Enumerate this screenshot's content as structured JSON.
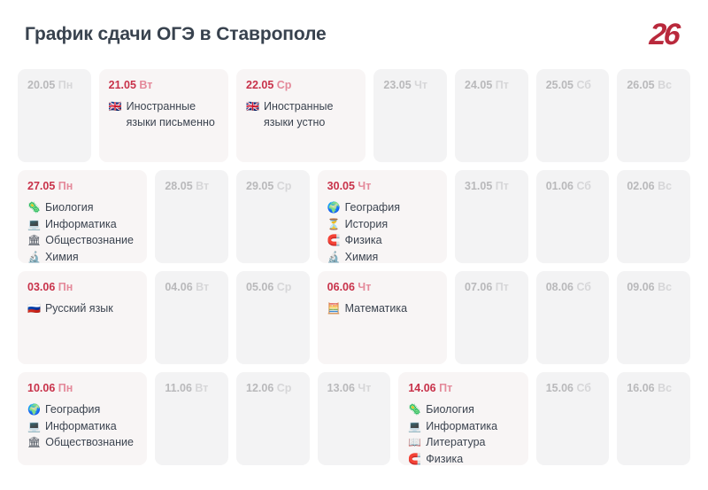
{
  "header": {
    "title": "График сдачи ОГЭ в Ставрополе",
    "logo_text": "26",
    "logo_icon": "logo-26-icon",
    "brand_color": "#b9293c"
  },
  "colors": {
    "title": "#38424e",
    "active_date": "#c8324a",
    "active_dow": "#e4899a",
    "inactive_date": "#b9b9bb",
    "inactive_dow": "#d6d6d8",
    "cell_inactive_bg": "#f3f3f4",
    "cell_active_bg": "#f8f5f5",
    "subject_text": "#3c4450",
    "page_bg": "#ffffff"
  },
  "calendar": {
    "weeks": [
      {
        "days": [
          {
            "date": "20.05",
            "dow": "Пн",
            "active": false,
            "subjects": []
          },
          {
            "date": "21.05",
            "dow": "Вт",
            "active": true,
            "subjects": [
              {
                "icon": "🇬🇧",
                "icon_name": "uk-flag-icon",
                "label": "Иностранные языки письменно"
              }
            ]
          },
          {
            "date": "22.05",
            "dow": "Ср",
            "active": true,
            "subjects": [
              {
                "icon": "🇬🇧",
                "icon_name": "uk-flag-icon",
                "label": "Иностранные языки устно"
              }
            ]
          },
          {
            "date": "23.05",
            "dow": "Чт",
            "active": false,
            "subjects": []
          },
          {
            "date": "24.05",
            "dow": "Пт",
            "active": false,
            "subjects": []
          },
          {
            "date": "25.05",
            "dow": "Сб",
            "active": false,
            "subjects": []
          },
          {
            "date": "26.05",
            "dow": "Вс",
            "active": false,
            "subjects": []
          }
        ]
      },
      {
        "days": [
          {
            "date": "27.05",
            "dow": "Пн",
            "active": true,
            "subjects": [
              {
                "icon": "🦠",
                "icon_name": "microbe-icon",
                "label": "Биология"
              },
              {
                "icon": "💻",
                "icon_name": "laptop-icon",
                "label": "Информатика"
              },
              {
                "icon": "🏛",
                "icon_name": "classical-building-icon",
                "label": "Обществознание"
              },
              {
                "icon": "🔬",
                "icon_name": "microscope-icon",
                "label": "Химия"
              }
            ]
          },
          {
            "date": "28.05",
            "dow": "Вт",
            "active": false,
            "subjects": []
          },
          {
            "date": "29.05",
            "dow": "Ср",
            "active": false,
            "subjects": []
          },
          {
            "date": "30.05",
            "dow": "Чт",
            "active": true,
            "subjects": [
              {
                "icon": "🌍",
                "icon_name": "globe-icon",
                "label": "География"
              },
              {
                "icon": "⏳",
                "icon_name": "hourglass-icon",
                "label": "История"
              },
              {
                "icon": "🧲",
                "icon_name": "magnet-icon",
                "label": "Физика"
              },
              {
                "icon": "🔬",
                "icon_name": "microscope-icon",
                "label": "Химия"
              }
            ]
          },
          {
            "date": "31.05",
            "dow": "Пт",
            "active": false,
            "subjects": []
          },
          {
            "date": "01.06",
            "dow": "Сб",
            "active": false,
            "subjects": []
          },
          {
            "date": "02.06",
            "dow": "Вс",
            "active": false,
            "subjects": []
          }
        ]
      },
      {
        "days": [
          {
            "date": "03.06",
            "dow": "Пн",
            "active": true,
            "subjects": [
              {
                "icon": "🇷🇺",
                "icon_name": "russia-flag-icon",
                "label": "Русский язык"
              }
            ]
          },
          {
            "date": "04.06",
            "dow": "Вт",
            "active": false,
            "subjects": []
          },
          {
            "date": "05.06",
            "dow": "Ср",
            "active": false,
            "subjects": []
          },
          {
            "date": "06.06",
            "dow": "Чт",
            "active": true,
            "subjects": [
              {
                "icon": "🧮",
                "icon_name": "abacus-icon",
                "label": "Математика"
              }
            ]
          },
          {
            "date": "07.06",
            "dow": "Пт",
            "active": false,
            "subjects": []
          },
          {
            "date": "08.06",
            "dow": "Сб",
            "active": false,
            "subjects": []
          },
          {
            "date": "09.06",
            "dow": "Вс",
            "active": false,
            "subjects": []
          }
        ]
      },
      {
        "days": [
          {
            "date": "10.06",
            "dow": "Пн",
            "active": true,
            "subjects": [
              {
                "icon": "🌍",
                "icon_name": "globe-icon",
                "label": "География"
              },
              {
                "icon": "💻",
                "icon_name": "laptop-icon",
                "label": "Информатика"
              },
              {
                "icon": "🏛",
                "icon_name": "classical-building-icon",
                "label": "Обществознание"
              }
            ]
          },
          {
            "date": "11.06",
            "dow": "Вт",
            "active": false,
            "subjects": []
          },
          {
            "date": "12.06",
            "dow": "Ср",
            "active": false,
            "subjects": []
          },
          {
            "date": "13.06",
            "dow": "Чт",
            "active": false,
            "subjects": []
          },
          {
            "date": "14.06",
            "dow": "Пт",
            "active": true,
            "subjects": [
              {
                "icon": "🦠",
                "icon_name": "microbe-icon",
                "label": "Биология"
              },
              {
                "icon": "💻",
                "icon_name": "laptop-icon",
                "label": "Информатика"
              },
              {
                "icon": "📖",
                "icon_name": "open-book-icon",
                "label": "Литература"
              },
              {
                "icon": "🧲",
                "icon_name": "magnet-icon",
                "label": "Физика"
              }
            ]
          },
          {
            "date": "15.06",
            "dow": "Сб",
            "active": false,
            "subjects": []
          },
          {
            "date": "16.06",
            "dow": "Вс",
            "active": false,
            "subjects": []
          }
        ]
      }
    ]
  }
}
